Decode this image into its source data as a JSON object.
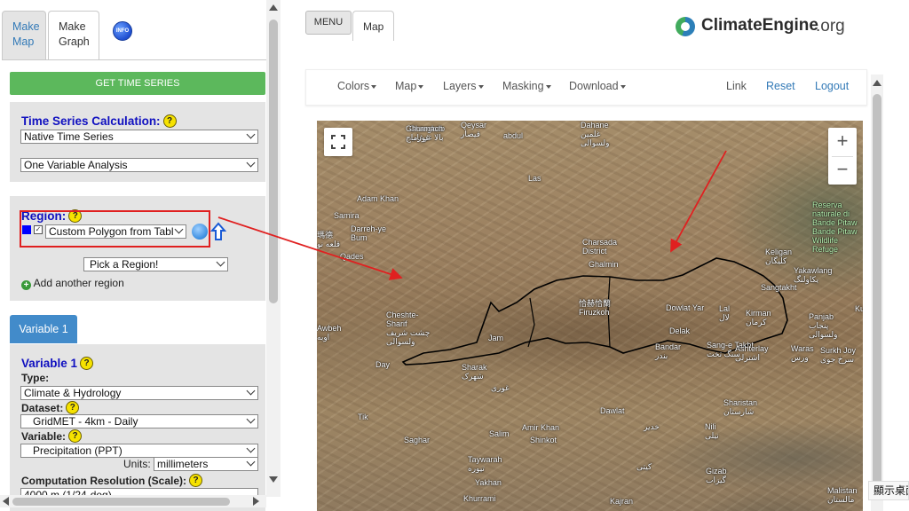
{
  "left_panel": {
    "tabs": [
      {
        "label": "Make Map"
      },
      {
        "label": "Make Graph"
      }
    ],
    "info_icon_text": "INFO",
    "get_time_series_label": "GET TIME SERIES",
    "calc": {
      "heading": "Time Series Calculation:",
      "method": "Native Time Series",
      "analysis": "One Variable Analysis"
    },
    "region": {
      "heading": "Region:",
      "color": "#0000ff",
      "checked": true,
      "selected": "Custom Polygon from Tabl",
      "pick": "Pick a Region!",
      "add_label": "Add another region"
    },
    "variable_tab": "Variable 1",
    "variable": {
      "heading": "Variable 1",
      "type_label": "Type:",
      "type_value": "Climate & Hydrology",
      "dataset_label": "Dataset:",
      "dataset_value": "GridMET - 4km - Daily",
      "variable_label": "Variable:",
      "variable_value": "Precipitation (PPT)",
      "units_label": "Units:",
      "units_value": "millimeters",
      "scale_label": "Computation Resolution (Scale):",
      "scale_value_partial": "4000 m (1/24-deg)"
    },
    "help_glyph": "?"
  },
  "header": {
    "menu_label": "MENU",
    "map_tab": "Map",
    "logo_bold": "ClimateEngine",
    "logo_suffix": ".org"
  },
  "navbar": {
    "dropdowns": [
      "Colors",
      "Map",
      "Layers",
      "Masking",
      "Download"
    ],
    "link": "Link",
    "reset": "Reset",
    "logout": "Logout"
  },
  "map": {
    "zoom_in": "+",
    "zoom_out": "−",
    "labels": [
      {
        "text": "Gharghab\nبالا غرغاب",
        "cls": ""
      },
      {
        "text": "Ghurmach\nغورماچ",
        "cls": ""
      },
      {
        "text": "Qeysar\nقیصار",
        "cls": ""
      },
      {
        "text": "abdul",
        "cls": ""
      },
      {
        "text": "Dahane\nغلمین\nولسوالی",
        "cls": ""
      },
      {
        "text": "Las",
        "cls": ""
      },
      {
        "text": "Adam Khan",
        "cls": ""
      },
      {
        "text": "Samira",
        "cls": ""
      },
      {
        "text": "Darreh-ye\nBum",
        "cls": ""
      },
      {
        "text": "瑪德\nقلعه نو",
        "cls": ""
      },
      {
        "text": "Qades",
        "cls": ""
      },
      {
        "text": "Charsada\nDistrict",
        "cls": ""
      },
      {
        "text": "Ghalmin",
        "cls": ""
      },
      {
        "text": "Reserva\nnaturale di\nBande Pitaw\nBande Pitaw\nWildlife\nRefuge",
        "cls": "green"
      },
      {
        "text": "Keligan\nکلیگان",
        "cls": ""
      },
      {
        "text": "Yakawlang\nیکاولنگ",
        "cls": ""
      },
      {
        "text": "Sangtakht",
        "cls": ""
      },
      {
        "text": "Cheshte-\nSharif\nچشت شریف\nولسوالی",
        "cls": ""
      },
      {
        "text": "Awbeh\nاوبه",
        "cls": ""
      },
      {
        "text": "恰赫恰蘭\nFiruzkoh",
        "cls": ""
      },
      {
        "text": "Dowlat Yar",
        "cls": ""
      },
      {
        "text": "Lal\nلال",
        "cls": ""
      },
      {
        "text": "Kirman\nکرمان",
        "cls": ""
      },
      {
        "text": "Panjab\nپنجاب\nولسوالی",
        "cls": ""
      },
      {
        "text": "Jam",
        "cls": ""
      },
      {
        "text": "Delak",
        "cls": ""
      },
      {
        "text": "Bandar\nبندر",
        "cls": ""
      },
      {
        "text": "Sang-e Takht\nسنگ تخت",
        "cls": ""
      },
      {
        "text": "Ashterlay\nاشترلی",
        "cls": ""
      },
      {
        "text": "Waras\nورس",
        "cls": ""
      },
      {
        "text": "Surkh Joy\nسرخ جوی",
        "cls": ""
      },
      {
        "text": "Day",
        "cls": ""
      },
      {
        "text": "Sharak\nشهرک",
        "cls": ""
      },
      {
        "text": "Sharistan\nشارستان",
        "cls": ""
      },
      {
        "text": "Dawlat",
        "cls": ""
      },
      {
        "text": "Tik",
        "cls": ""
      },
      {
        "text": "Amir Khan",
        "cls": ""
      },
      {
        "text": "Saghar",
        "cls": ""
      },
      {
        "text": "Salim",
        "cls": ""
      },
      {
        "text": "Shinkot",
        "cls": ""
      },
      {
        "text": "Nili\nنیلی",
        "cls": ""
      },
      {
        "text": "Taywarah\nتیوره",
        "cls": ""
      },
      {
        "text": "Yakhan",
        "cls": ""
      },
      {
        "text": "Gizab\nگیزاب",
        "cls": ""
      },
      {
        "text": "Khurrami",
        "cls": ""
      },
      {
        "text": "Kajran",
        "cls": ""
      },
      {
        "text": "Malistan\nمالستان",
        "cls": ""
      },
      {
        "text": "Ku",
        "cls": ""
      },
      {
        "text": "غوری",
        "cls": ""
      },
      {
        "text": "خدیر",
        "cls": ""
      },
      {
        "text": "کیتی",
        "cls": ""
      }
    ]
  },
  "status": {
    "ime_text": "顯示桌面"
  },
  "colors": {
    "annotation": "#e02020",
    "boundary": "#000000"
  }
}
